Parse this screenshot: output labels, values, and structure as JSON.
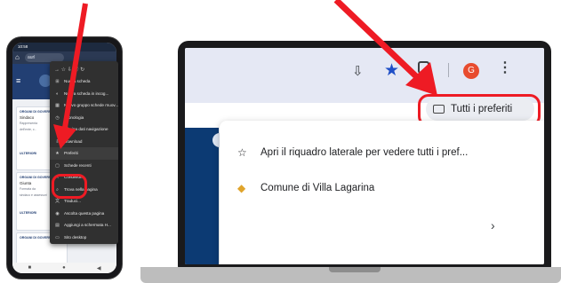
{
  "phone": {
    "status_time": "10:58",
    "url_text": "aurl",
    "menu_items": [
      {
        "icon": "new-tab-icon",
        "glyph": "⊞",
        "label": "Nuova scheda"
      },
      {
        "icon": "incognito-icon",
        "glyph": "◐",
        "label": "Nuova scheda in incog..."
      },
      {
        "icon": "tab-group-icon",
        "glyph": "▦",
        "label": "Nuovo gruppo schede rnuov..."
      },
      {
        "icon": "history-icon",
        "glyph": "◷",
        "label": "Cronologia"
      },
      {
        "icon": "clear-data-icon",
        "glyph": "▣",
        "label": "Elimina dati navigazione"
      },
      {
        "icon": "download-icon",
        "glyph": "⇩",
        "label": "Download"
      },
      {
        "icon": "star-icon",
        "glyph": "★",
        "label": "Preferiti"
      },
      {
        "icon": "recent-tabs-icon",
        "glyph": "▢",
        "label": "Schede recenti"
      },
      {
        "icon": "share-icon",
        "glyph": "<",
        "label": "Condividi..."
      },
      {
        "icon": "find-icon",
        "glyph": "⌕",
        "label": "Trova nella pagina"
      },
      {
        "icon": "translate-icon",
        "glyph": "文",
        "label": "Traduci..."
      },
      {
        "icon": "listen-icon",
        "glyph": "◉",
        "label": "Ascolta questa pagina"
      },
      {
        "icon": "home-screen-icon",
        "glyph": "▤",
        "label": "Aggiungi a schermata H..."
      },
      {
        "icon": "desktop-site-icon",
        "glyph": "▭",
        "label": "Sito desktop"
      }
    ],
    "cards": [
      {
        "title": "ORGANI DI GOVERNO",
        "text": "Sindaco",
        "lines": [
          "Rappresenta",
          "dell'ente, c.."
        ],
        "link": "ULTERIORI"
      },
      {
        "title": "ORGANI DI GOVERNO",
        "text": "Giunta",
        "lines": [
          "Formata da",
          "sindaco e assessori"
        ],
        "link": "ULTERIORI"
      },
      {
        "title": "ORGANI DI GOVERNO",
        "text": "",
        "lines": [],
        "link": ""
      }
    ]
  },
  "laptop": {
    "avatar_letter": "G",
    "all_bookmarks_label": "Tutti i preferiti",
    "dropdown_items": [
      {
        "icon": "star-outline-icon",
        "glyph": "☆",
        "label": "Apri il riquadro laterale per vedere tutti i pref..."
      },
      {
        "icon": "site-favicon-icon",
        "glyph": "◆",
        "label": "Comune di Villa Lagarina"
      }
    ]
  },
  "colors": {
    "arrow_red": "#ee1b24",
    "star_blue": "#1f4fc7",
    "site_navy": "#0c3a73",
    "avatar": "#e84c2f"
  }
}
